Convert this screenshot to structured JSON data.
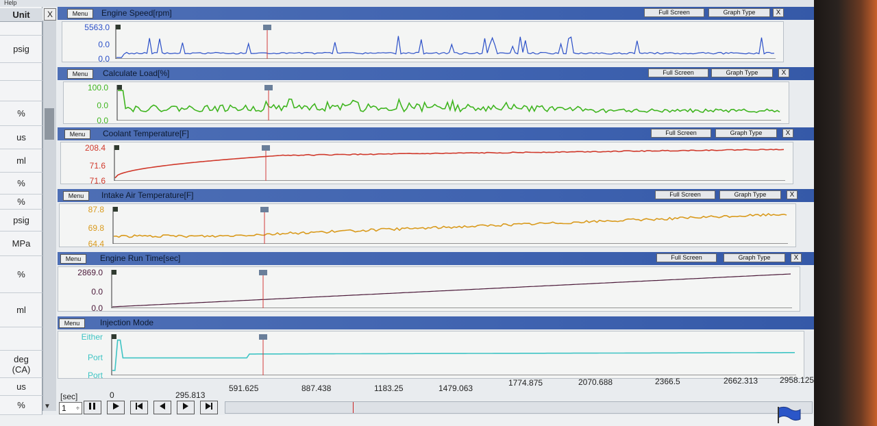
{
  "menubar": {
    "text": "Help"
  },
  "unit_column": {
    "header": "Unit",
    "close_label": "X",
    "units": [
      "",
      "psig",
      "",
      "",
      "%",
      "us",
      "ml",
      "%",
      "%",
      "psig",
      "MPa",
      "%",
      "ml",
      "",
      "deg\n(CA)",
      "us",
      "%"
    ]
  },
  "panels": [
    {
      "menu_label": "Menu",
      "title": "Engine Speed[rpm]",
      "full_screen_label": "Full Screen",
      "graph_type_label": "Graph Type",
      "close_label": "X",
      "y_labels": [
        "5563.0",
        "0.0",
        "0.0"
      ],
      "color": "#2a4fc8"
    },
    {
      "menu_label": "Menu",
      "title": "Calculate Load[%]",
      "full_screen_label": "Full Screen",
      "graph_type_label": "Graph Type",
      "close_label": "X",
      "y_labels": [
        "100.0",
        "0.0",
        "0.0"
      ],
      "color": "#3fb51f"
    },
    {
      "menu_label": "Menu",
      "title": "Coolant Temperature[F]",
      "full_screen_label": "Full Screen",
      "graph_type_label": "Graph Type",
      "close_label": "X",
      "y_labels": [
        "208.4",
        "71.6",
        "71.6"
      ],
      "color": "#d0382a"
    },
    {
      "menu_label": "Menu",
      "title": "Intake Air Temperature[F]",
      "full_screen_label": "Full Screen",
      "graph_type_label": "Graph Type",
      "close_label": "X",
      "y_labels": [
        "87.8",
        "69.8",
        "64.4"
      ],
      "color": "#d99a1c"
    },
    {
      "menu_label": "Menu",
      "title": "Engine Run Time[sec]",
      "full_screen_label": "Full Screen",
      "graph_type_label": "Graph Type",
      "close_label": "X",
      "y_labels": [
        "2869.0",
        "0.0",
        "0.0"
      ],
      "color": "#4a1838"
    },
    {
      "menu_label": "Menu",
      "title": "Injection Mode",
      "full_screen_label": "",
      "graph_type_label": "",
      "close_label": "",
      "y_labels": [
        "Either",
        "Port",
        "Port"
      ],
      "color": "#3ec4c4"
    }
  ],
  "x_axis": {
    "unit_label": "[sec]",
    "ticks": [
      "0",
      "295.813",
      "591.625",
      "887.438",
      "1183.25",
      "1479.063",
      "1774.875",
      "2070.688",
      "2366.5",
      "2662.313",
      "2958.125"
    ]
  },
  "toolbar": {
    "zoom_value": "1",
    "icons": [
      "pause-icon",
      "play-icon",
      "skip-start-icon",
      "step-back-icon",
      "step-forward-icon",
      "skip-end-icon"
    ]
  }
}
